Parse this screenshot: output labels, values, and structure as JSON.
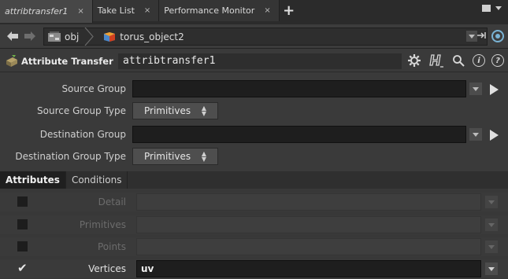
{
  "tabs": [
    {
      "label": "attribtransfer1",
      "italic": true,
      "active": true
    },
    {
      "label": "Take List",
      "italic": false,
      "active": false
    },
    {
      "label": "Performance Monitor",
      "italic": false,
      "active": false
    }
  ],
  "tab_close_glyph": "×",
  "tab_add_glyph": "+",
  "path": {
    "back_glyph": "🡄",
    "forward_glyph": "🡆",
    "crumbs": [
      {
        "label": "obj",
        "icon": "obj-network-icon"
      },
      {
        "label": "torus_object2",
        "icon": "geometry-object-icon"
      }
    ]
  },
  "node": {
    "type_label": "Attribute Transfer",
    "name": "attribtransfer1",
    "icons": [
      "gear-icon",
      "help-h-icon",
      "magnifier-icon",
      "info-icon",
      "question-icon"
    ]
  },
  "params": {
    "source_group": {
      "label": "Source Group",
      "value": ""
    },
    "source_group_type": {
      "label": "Source Group Type",
      "value": "Primitives"
    },
    "destination_group": {
      "label": "Destination Group",
      "value": ""
    },
    "destination_group_type": {
      "label": "Destination Group Type",
      "value": "Primitives"
    }
  },
  "subtabs": [
    "Attributes",
    "Conditions"
  ],
  "attributes": [
    {
      "label": "Detail",
      "checked": false,
      "value": ""
    },
    {
      "label": "Primitives",
      "checked": false,
      "value": ""
    },
    {
      "label": "Points",
      "checked": false,
      "value": ""
    },
    {
      "label": "Vertices",
      "checked": true,
      "value": "uv"
    }
  ],
  "check_glyph": "✔",
  "colors": {
    "accent_blue": "#7ab3d4",
    "field_bg": "#1e1e1e",
    "panel_bg": "#3a3a3a"
  }
}
